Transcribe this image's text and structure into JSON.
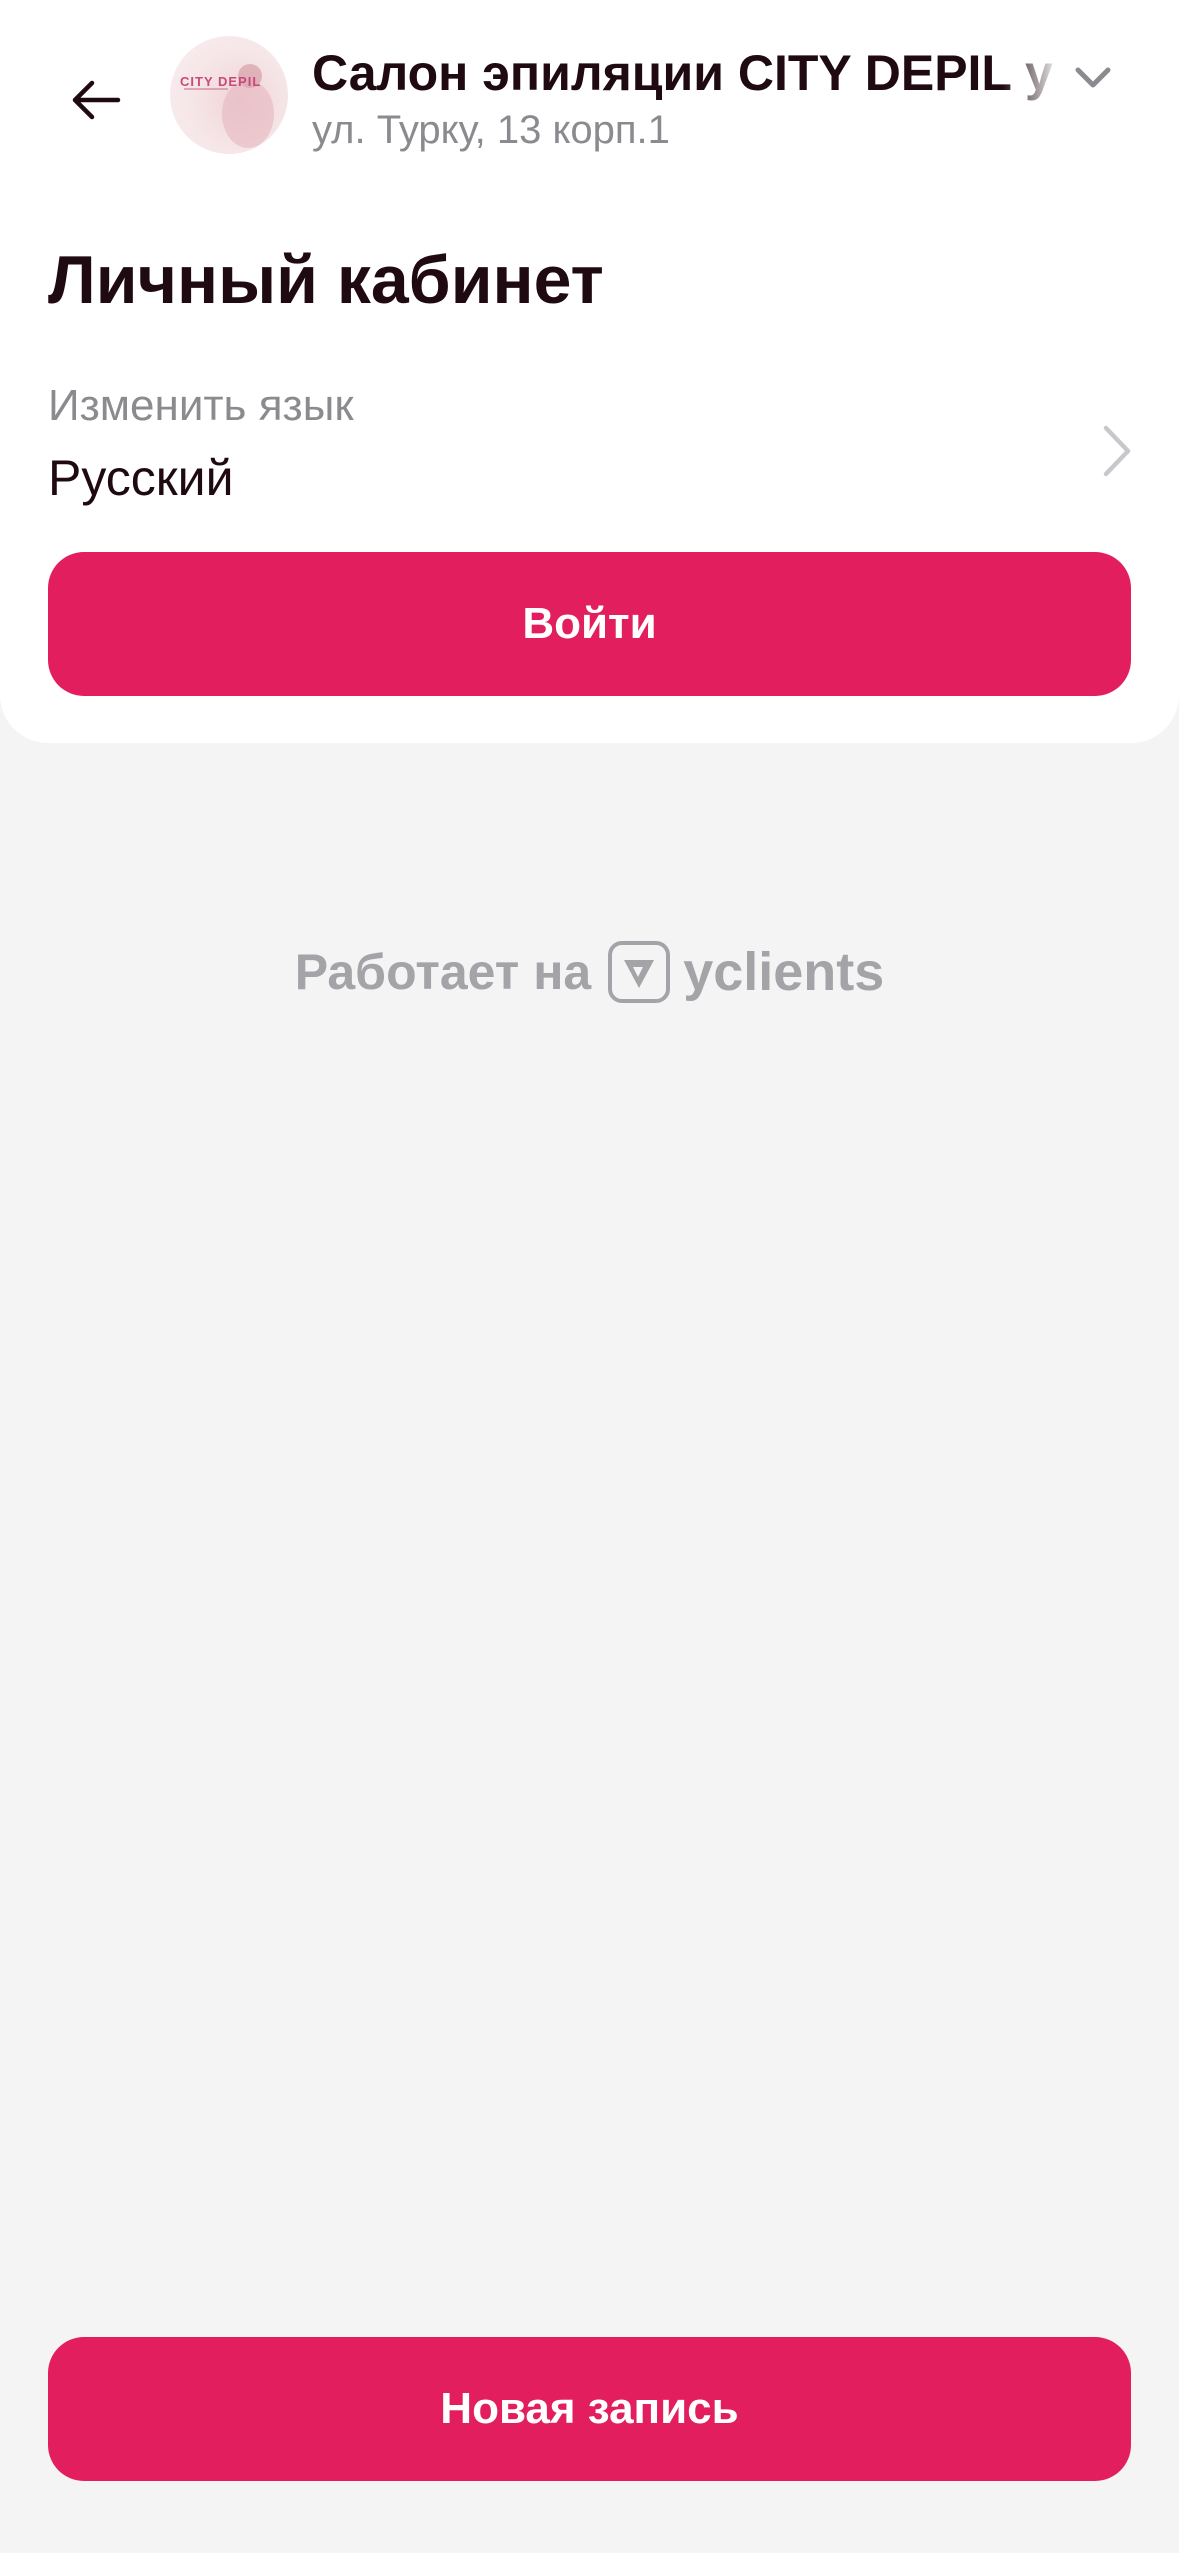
{
  "header": {
    "back_icon": "arrow-left-icon",
    "salon_name": "Салон эпиляции CITY DEPIL у",
    "address": "ул. Турку, 13 корп.1",
    "avatar_logo_text": "CITY DEPIL",
    "expand_icon": "chevron-down-icon"
  },
  "page": {
    "title": "Личный кабинет"
  },
  "language": {
    "label": "Изменить язык",
    "value": "Русский",
    "chevron_icon": "chevron-right-icon"
  },
  "buttons": {
    "login_label": "Войти",
    "new_booking_label": "Новая запись"
  },
  "footer": {
    "powered_text": "Работает на",
    "brand_icon": "yclients-logo-icon",
    "brand_name": "yclients"
  },
  "colors": {
    "accent": "#e31e5f",
    "background": "#f4f4f5",
    "card": "#ffffff",
    "text_primary": "#1e0a10",
    "text_secondary": "#8b8b8f",
    "muted_brand": "#a4a4a8"
  }
}
